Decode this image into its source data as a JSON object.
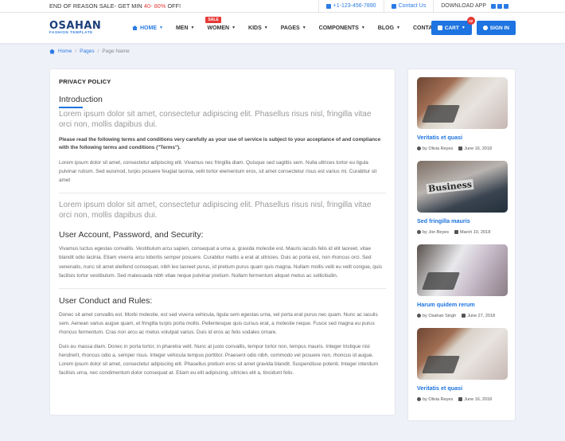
{
  "topbar": {
    "promo_pre": "END OF REASON SALE- GET MIN ",
    "promo_a": "40-",
    "promo_b": " 80%",
    "promo_post": " OFF!",
    "phone": "+1-123-456-7890",
    "contact": "Contact Us",
    "download": "DOWNLOAD APP"
  },
  "logo": {
    "brand": "OSAHAN",
    "tagline": "FASHION TEMPLATE"
  },
  "menu": [
    {
      "label": "HOME",
      "caret": "▼"
    },
    {
      "label": "MEN",
      "caret": "▼"
    },
    {
      "label": "WOMEN",
      "caret": "▼",
      "badge": "SALE"
    },
    {
      "label": "KIDS",
      "caret": "▼"
    },
    {
      "label": "PAGES",
      "caret": "▼"
    },
    {
      "label": "COMPONENTS",
      "caret": "▼"
    },
    {
      "label": "BLOG",
      "caret": "▼"
    },
    {
      "label": "CONTACT"
    }
  ],
  "cart": {
    "label": "CART",
    "caret": "▼",
    "count": "02"
  },
  "signin": {
    "label": "SIGN IN"
  },
  "breadcrumb": {
    "home": "Home",
    "pages": "Pages",
    "current": "Page Name",
    "sep": "/"
  },
  "content": {
    "title": "PRIVACY POLICY",
    "intro_heading": "Introduction",
    "lead1": "Lorem ipsum dolor sit amet, consectetur adipiscing elit. Phasellus risus nisl, fringilla vitae orci non, mollis dapibus dui.",
    "bold_para": "Please read the following terms and conditions very carefully as your use of service is subject to your acceptance of and compliance with the following terms and conditions (\"Terms\").",
    "para1": "Lorem ipsum dolor sit amet, consectetur adipiscing elit. Vivamus nec fringilla diam. Quisque sed sagittis sem. Nulla ultrices tortor eu ligula pulvinar rutrum. Sed euismod, turpis posuere feugiat lacinia, velit tortor elementum eros, sit amet consectetur risus est varius mi. Curabitur sit amet",
    "lead2": "Lorem ipsum dolor sit amet, consectetur adipiscing elit. Phasellus risus nisl, fringilla vitae orci non, mollis dapibus dui.",
    "section2_heading": "User Account, Password, and Security:",
    "para2": "Vivamus luctus egestas convallis. Vestibulum arcu sapien, consequat a urna a, gravida molestie est. Mauris iaculis felis id elit laoreet, vitae blandit odio lacinia. Etiam viverra arcu lobortis semper posuere. Curabitur mattis a erat at ultricies. Duis ac porta est, non rhoncus orci. Sed venenatis, nunc sit amet eleifend consequat, nibh leo laoreet purus, id pretium purus quam quis magna. Nullam mollis velit eu velit congue, quis facilisis tortor vestibulum. Sed malesuada nibh vitae neque pulvinar pretium. Nullam fermentum aliquet metus ac sollicitudin.",
    "section3_heading": "User Conduct and Rules:",
    "para3": "Donec sit amet convallis est. Morbi molestie, est sed viverra vehicula, ligula sem egestas urna, vel porta erat purus nec quam. Nunc ac iaculis sem. Aenean varius augue quam, et fringilla turpis porta mollis. Pellentesque quis cursus erat, a molestie neque. Fusce sed magna eu purus rhoncus fermentum. Cras non arcu ac metus volutpat varius. Duis id eros ac felis sodales ornare.",
    "para4": "Duis eu massa diam. Donec in porta tortor, in pharetra velit. Nunc at justo convallis, tempor tortor non, tempus mauris. Integer tristique nisl hendrerit, rhoncus odio a, semper risus. Integer vehicula tempus porttitor. Praesent odio nibh, commodo vel posuere non, rhoncus id augue. Lorem ipsum dolor sit amet, consectetur adipiscing elit. Phasellus pretium eros sit amet gravida blandit. Suspendisse potenti. Integer interdum facilisis urna, nec condimentum dolor consequat at. Etiam eu elit adipiscing, ultricies elit a, tincidunt felis."
  },
  "sidebar": {
    "posts": [
      {
        "title": "Veritatis et quasi",
        "author": "by Olivia Reyes",
        "date": "June 16, 2018"
      },
      {
        "title": "Sed fringilla mauris",
        "author": "by Jon Beyes",
        "date": "March 10, 2018",
        "image_text": "Business"
      },
      {
        "title": "Harum quidem rerum",
        "author": "by Osahan Singh",
        "date": "June 27, 2018"
      },
      {
        "title": "Veritatis et quasi",
        "author": "by Olivia Reyes",
        "date": "June 16, 2018"
      }
    ]
  },
  "colors": {
    "accent": "#1e74e0",
    "sale": "#e53935",
    "logo": "#1d3e7a"
  }
}
